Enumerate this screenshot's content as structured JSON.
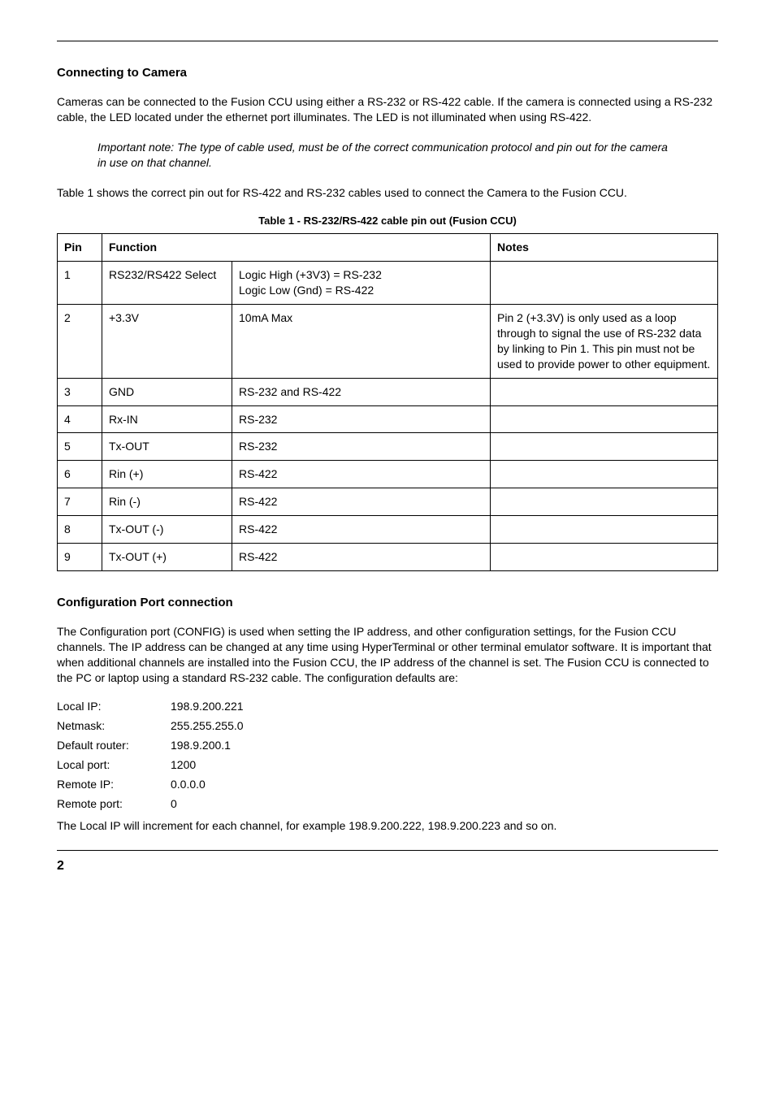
{
  "section1": {
    "heading": "Connecting to Camera",
    "para1": "Cameras can be connected to the Fusion CCU using either a RS-232 or RS-422 cable. If the camera is connected using a RS-232 cable, the LED located under the ethernet port illuminates. The LED is not illuminated when using RS-422.",
    "note": "Important note: The type of cable used, must be of the correct communication protocol and pin out for the camera in use on that channel.",
    "para2": "Table 1 shows the correct pin out for RS-422 and RS-232 cables used to connect the Camera to the Fusion CCU."
  },
  "table": {
    "caption": "Table 1 - RS-232/RS-422 cable pin out (Fusion CCU)",
    "head_pin": "Pin",
    "head_function": "Function",
    "head_notes": "Notes",
    "rows": [
      {
        "pin": "1",
        "f1": "RS232/RS422 Select",
        "f2": "Logic High (+3V3) = RS-232\nLogic Low (Gnd) = RS-422",
        "notes": ""
      },
      {
        "pin": "2",
        "f1": "+3.3V",
        "f2": "10mA Max",
        "notes": "Pin 2 (+3.3V) is only used as a loop through to signal the use of RS-232 data by linking to Pin 1. This pin must not be used to provide power to other equipment."
      },
      {
        "pin": "3",
        "f1": "GND",
        "f2": "RS-232 and RS-422",
        "notes": ""
      },
      {
        "pin": "4",
        "f1": "Rx-IN",
        "f2": "RS-232",
        "notes": ""
      },
      {
        "pin": "5",
        "f1": "Tx-OUT",
        "f2": "RS-232",
        "notes": ""
      },
      {
        "pin": "6",
        "f1": "Rin (+)",
        "f2": "RS-422",
        "notes": ""
      },
      {
        "pin": "7",
        "f1": "Rin (-)",
        "f2": "RS-422",
        "notes": ""
      },
      {
        "pin": "8",
        "f1": "Tx-OUT (-)",
        "f2": "RS-422",
        "notes": ""
      },
      {
        "pin": "9",
        "f1": "Tx-OUT (+)",
        "f2": "RS-422",
        "notes": ""
      }
    ]
  },
  "section2": {
    "heading": "Configuration Port connection",
    "para1": "The Configuration port (CONFIG) is used when setting the IP address, and other configuration settings, for the Fusion CCU channels. The IP address can be changed at any time using HyperTerminal or other terminal emulator software. It is important that when additional channels are installed into the Fusion CCU, the IP address of the channel is set. The Fusion CCU is connected to the PC or laptop using a standard RS-232 cable. The configuration defaults are:",
    "defaults": [
      {
        "label": "Local IP:",
        "value": "198.9.200.221"
      },
      {
        "label": "Netmask:",
        "value": "255.255.255.0"
      },
      {
        "label": "Default router:",
        "value": "198.9.200.1"
      },
      {
        "label": "Local port:",
        "value": "1200"
      },
      {
        "label": "Remote IP:",
        "value": "0.0.0.0"
      },
      {
        "label": "Remote port:",
        "value": "0"
      }
    ],
    "para2": "The Local IP will increment for each channel, for example 198.9.200.222, 198.9.200.223 and so on."
  },
  "page_number": "2"
}
